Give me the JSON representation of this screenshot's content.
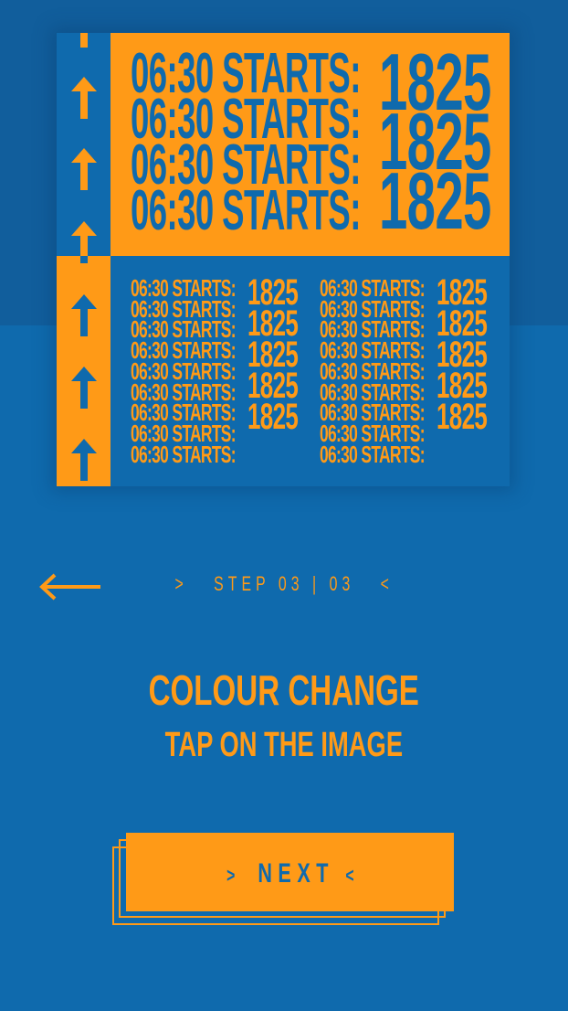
{
  "poster": {
    "line_label": "06:30 STARTS:",
    "year": "1825"
  },
  "nav": {
    "back_icon": "arrow-left-icon",
    "step_prefix": ">",
    "step_text": "STEP 03 | 03",
    "step_suffix": "<"
  },
  "content": {
    "title": "COLOUR CHANGE",
    "subtitle": "TAP ON THE IMAGE"
  },
  "button": {
    "prefix": ">",
    "label": "NEXT",
    "suffix": "<"
  },
  "colors": {
    "orange": "#ff9a17",
    "blue": "#0f6aad",
    "blue_dark": "#115e9c"
  }
}
